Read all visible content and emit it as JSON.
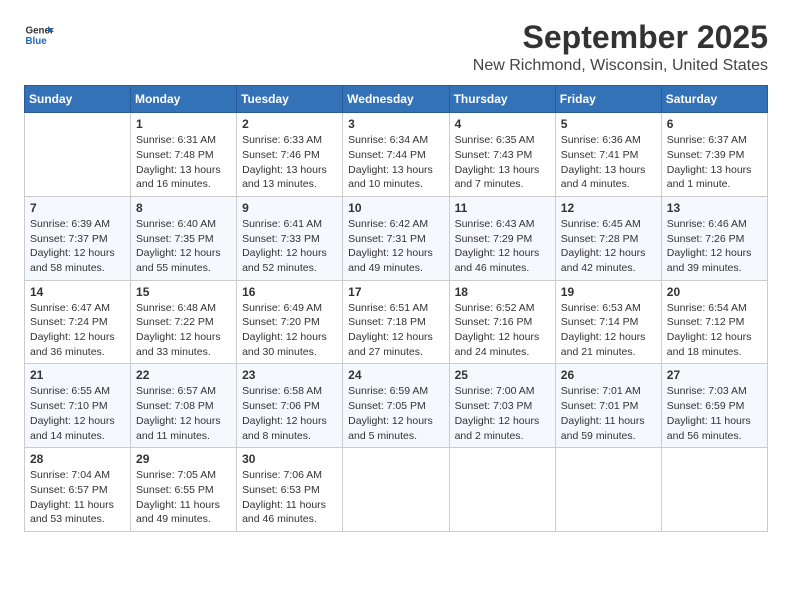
{
  "header": {
    "logo_line1": "General",
    "logo_line2": "Blue",
    "title": "September 2025",
    "subtitle": "New Richmond, Wisconsin, United States"
  },
  "weekdays": [
    "Sunday",
    "Monday",
    "Tuesday",
    "Wednesday",
    "Thursday",
    "Friday",
    "Saturday"
  ],
  "weeks": [
    [
      {
        "day": "",
        "sunrise": "",
        "sunset": "",
        "daylight": ""
      },
      {
        "day": "1",
        "sunrise": "Sunrise: 6:31 AM",
        "sunset": "Sunset: 7:48 PM",
        "daylight": "Daylight: 13 hours and 16 minutes."
      },
      {
        "day": "2",
        "sunrise": "Sunrise: 6:33 AM",
        "sunset": "Sunset: 7:46 PM",
        "daylight": "Daylight: 13 hours and 13 minutes."
      },
      {
        "day": "3",
        "sunrise": "Sunrise: 6:34 AM",
        "sunset": "Sunset: 7:44 PM",
        "daylight": "Daylight: 13 hours and 10 minutes."
      },
      {
        "day": "4",
        "sunrise": "Sunrise: 6:35 AM",
        "sunset": "Sunset: 7:43 PM",
        "daylight": "Daylight: 13 hours and 7 minutes."
      },
      {
        "day": "5",
        "sunrise": "Sunrise: 6:36 AM",
        "sunset": "Sunset: 7:41 PM",
        "daylight": "Daylight: 13 hours and 4 minutes."
      },
      {
        "day": "6",
        "sunrise": "Sunrise: 6:37 AM",
        "sunset": "Sunset: 7:39 PM",
        "daylight": "Daylight: 13 hours and 1 minute."
      }
    ],
    [
      {
        "day": "7",
        "sunrise": "Sunrise: 6:39 AM",
        "sunset": "Sunset: 7:37 PM",
        "daylight": "Daylight: 12 hours and 58 minutes."
      },
      {
        "day": "8",
        "sunrise": "Sunrise: 6:40 AM",
        "sunset": "Sunset: 7:35 PM",
        "daylight": "Daylight: 12 hours and 55 minutes."
      },
      {
        "day": "9",
        "sunrise": "Sunrise: 6:41 AM",
        "sunset": "Sunset: 7:33 PM",
        "daylight": "Daylight: 12 hours and 52 minutes."
      },
      {
        "day": "10",
        "sunrise": "Sunrise: 6:42 AM",
        "sunset": "Sunset: 7:31 PM",
        "daylight": "Daylight: 12 hours and 49 minutes."
      },
      {
        "day": "11",
        "sunrise": "Sunrise: 6:43 AM",
        "sunset": "Sunset: 7:29 PM",
        "daylight": "Daylight: 12 hours and 46 minutes."
      },
      {
        "day": "12",
        "sunrise": "Sunrise: 6:45 AM",
        "sunset": "Sunset: 7:28 PM",
        "daylight": "Daylight: 12 hours and 42 minutes."
      },
      {
        "day": "13",
        "sunrise": "Sunrise: 6:46 AM",
        "sunset": "Sunset: 7:26 PM",
        "daylight": "Daylight: 12 hours and 39 minutes."
      }
    ],
    [
      {
        "day": "14",
        "sunrise": "Sunrise: 6:47 AM",
        "sunset": "Sunset: 7:24 PM",
        "daylight": "Daylight: 12 hours and 36 minutes."
      },
      {
        "day": "15",
        "sunrise": "Sunrise: 6:48 AM",
        "sunset": "Sunset: 7:22 PM",
        "daylight": "Daylight: 12 hours and 33 minutes."
      },
      {
        "day": "16",
        "sunrise": "Sunrise: 6:49 AM",
        "sunset": "Sunset: 7:20 PM",
        "daylight": "Daylight: 12 hours and 30 minutes."
      },
      {
        "day": "17",
        "sunrise": "Sunrise: 6:51 AM",
        "sunset": "Sunset: 7:18 PM",
        "daylight": "Daylight: 12 hours and 27 minutes."
      },
      {
        "day": "18",
        "sunrise": "Sunrise: 6:52 AM",
        "sunset": "Sunset: 7:16 PM",
        "daylight": "Daylight: 12 hours and 24 minutes."
      },
      {
        "day": "19",
        "sunrise": "Sunrise: 6:53 AM",
        "sunset": "Sunset: 7:14 PM",
        "daylight": "Daylight: 12 hours and 21 minutes."
      },
      {
        "day": "20",
        "sunrise": "Sunrise: 6:54 AM",
        "sunset": "Sunset: 7:12 PM",
        "daylight": "Daylight: 12 hours and 18 minutes."
      }
    ],
    [
      {
        "day": "21",
        "sunrise": "Sunrise: 6:55 AM",
        "sunset": "Sunset: 7:10 PM",
        "daylight": "Daylight: 12 hours and 14 minutes."
      },
      {
        "day": "22",
        "sunrise": "Sunrise: 6:57 AM",
        "sunset": "Sunset: 7:08 PM",
        "daylight": "Daylight: 12 hours and 11 minutes."
      },
      {
        "day": "23",
        "sunrise": "Sunrise: 6:58 AM",
        "sunset": "Sunset: 7:06 PM",
        "daylight": "Daylight: 12 hours and 8 minutes."
      },
      {
        "day": "24",
        "sunrise": "Sunrise: 6:59 AM",
        "sunset": "Sunset: 7:05 PM",
        "daylight": "Daylight: 12 hours and 5 minutes."
      },
      {
        "day": "25",
        "sunrise": "Sunrise: 7:00 AM",
        "sunset": "Sunset: 7:03 PM",
        "daylight": "Daylight: 12 hours and 2 minutes."
      },
      {
        "day": "26",
        "sunrise": "Sunrise: 7:01 AM",
        "sunset": "Sunset: 7:01 PM",
        "daylight": "Daylight: 11 hours and 59 minutes."
      },
      {
        "day": "27",
        "sunrise": "Sunrise: 7:03 AM",
        "sunset": "Sunset: 6:59 PM",
        "daylight": "Daylight: 11 hours and 56 minutes."
      }
    ],
    [
      {
        "day": "28",
        "sunrise": "Sunrise: 7:04 AM",
        "sunset": "Sunset: 6:57 PM",
        "daylight": "Daylight: 11 hours and 53 minutes."
      },
      {
        "day": "29",
        "sunrise": "Sunrise: 7:05 AM",
        "sunset": "Sunset: 6:55 PM",
        "daylight": "Daylight: 11 hours and 49 minutes."
      },
      {
        "day": "30",
        "sunrise": "Sunrise: 7:06 AM",
        "sunset": "Sunset: 6:53 PM",
        "daylight": "Daylight: 11 hours and 46 minutes."
      },
      {
        "day": "",
        "sunrise": "",
        "sunset": "",
        "daylight": ""
      },
      {
        "day": "",
        "sunrise": "",
        "sunset": "",
        "daylight": ""
      },
      {
        "day": "",
        "sunrise": "",
        "sunset": "",
        "daylight": ""
      },
      {
        "day": "",
        "sunrise": "",
        "sunset": "",
        "daylight": ""
      }
    ]
  ]
}
